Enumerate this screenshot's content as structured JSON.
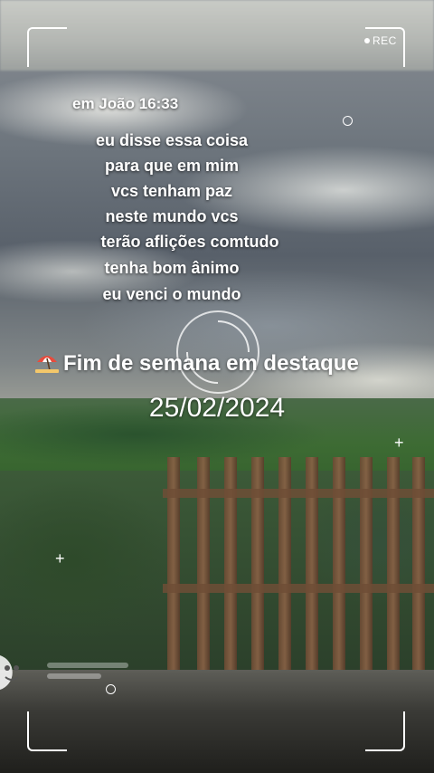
{
  "camera": {
    "rec_label": "REC"
  },
  "verse": {
    "reference": "em  João 16:33",
    "lines": [
      "eu disse essa coisa",
      "para que em mim",
      "vcs tenham paz",
      "neste mundo vcs",
      "terão aflições comtudo",
      "tenha bom ânimo",
      "eu venci o mundo"
    ]
  },
  "headline": {
    "icon": "beach-umbrella-icon",
    "text": "Fim de semana em destaque"
  },
  "date": "25/02/2024"
}
